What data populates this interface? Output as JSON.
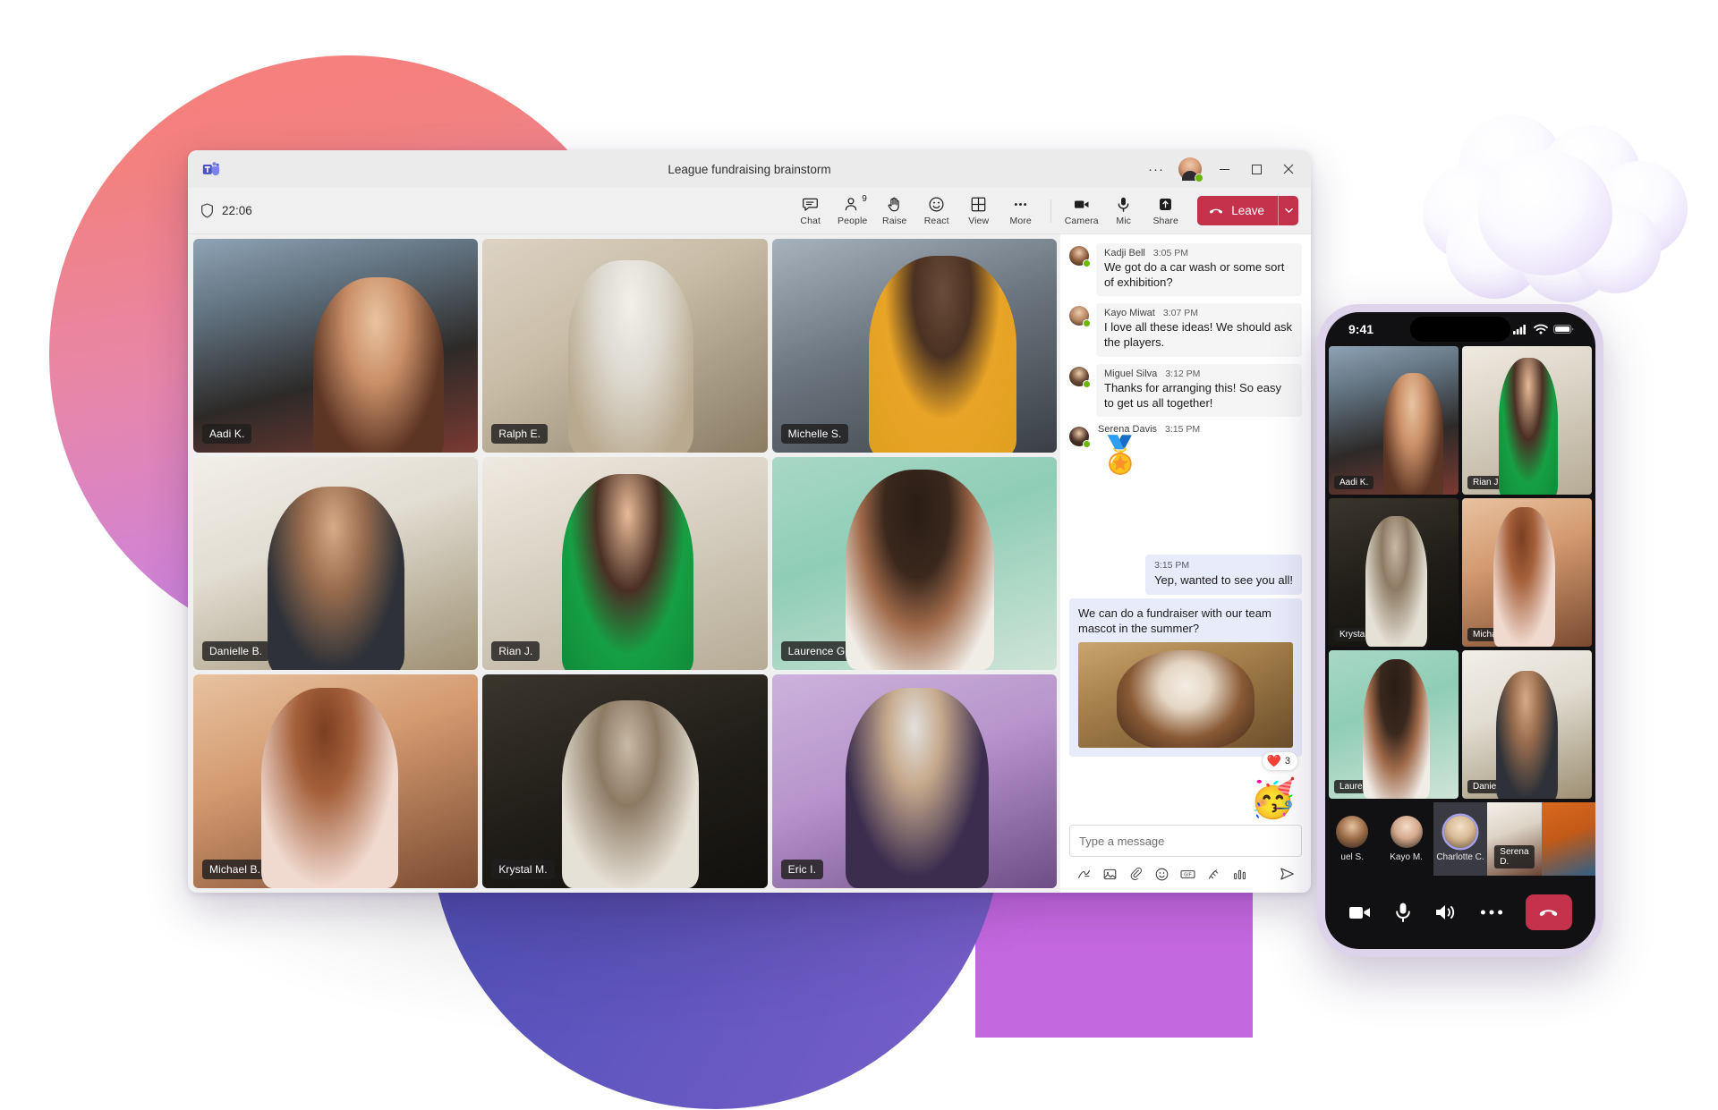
{
  "window": {
    "app_logo": "teams-logo",
    "title": "League fundraising brainstorm",
    "more_options": "···",
    "minimize": "─",
    "maximize": "□",
    "close": "✕"
  },
  "toolbar": {
    "timer": "22:06",
    "shield_icon": "shield-icon",
    "items": [
      {
        "label": "Chat",
        "icon": "chat-icon",
        "badge": ""
      },
      {
        "label": "People",
        "icon": "people-icon",
        "badge": "9"
      },
      {
        "label": "Raise",
        "icon": "raise-hand-icon",
        "badge": ""
      },
      {
        "label": "React",
        "icon": "react-icon",
        "badge": ""
      },
      {
        "label": "View",
        "icon": "view-grid-icon",
        "badge": ""
      },
      {
        "label": "More",
        "icon": "more-icon",
        "badge": ""
      }
    ],
    "device_items": [
      {
        "label": "Camera",
        "icon": "camera-icon"
      },
      {
        "label": "Mic",
        "icon": "microphone-icon"
      },
      {
        "label": "Share",
        "icon": "share-screen-icon"
      }
    ],
    "leave_label": "Leave",
    "leave_color": "#c4314b",
    "leave_chevron": "⌄"
  },
  "video_grid": {
    "tiles": [
      {
        "name": "Aadi K.",
        "art": "t-aadi"
      },
      {
        "name": "Ralph E.",
        "art": "t-ralph"
      },
      {
        "name": "Michelle S.",
        "art": "t-michelle"
      },
      {
        "name": "Danielle B.",
        "art": "t-danielle"
      },
      {
        "name": "Rian J.",
        "art": "t-rian"
      },
      {
        "name": "Laurence G.",
        "art": "t-laurence"
      },
      {
        "name": "Michael B.",
        "art": "t-michael"
      },
      {
        "name": "Krystal M.",
        "art": "t-krystal"
      },
      {
        "name": "Eric I.",
        "art": "t-eric"
      }
    ]
  },
  "chat": {
    "messages": [
      {
        "author": "Kadji Bell",
        "time": "3:05 PM",
        "text": "We got do a car wash or some sort of exhibition?",
        "avatar_color": "#8a5a3a"
      },
      {
        "author": "Kayo Miwat",
        "time": "3:07 PM",
        "text": "I love all these ideas! We should ask the players.",
        "avatar_color": "#b08060"
      },
      {
        "author": "Miguel Silva",
        "time": "3:12 PM",
        "text": "Thanks for arranging this! So easy to get us all together!",
        "avatar_color": "#6a4a34"
      },
      {
        "author": "Serena Davis",
        "time": "3:15 PM",
        "text": "",
        "sticker": "🏅",
        "avatar_color": "#4a3126"
      }
    ],
    "own_messages": [
      {
        "time": "3:15 PM",
        "text": "Yep, wanted to see you all!"
      },
      {
        "time": "",
        "text": "We can do a fundraiser with our team mascot in the summer?",
        "has_photo": true,
        "photo_alt": "bulldog-photo"
      }
    ],
    "reaction": {
      "emoji": "❤️",
      "count": "3"
    },
    "big_emoji": "🥳",
    "composer_placeholder": "Type a message",
    "composer_icons": [
      "format-icon",
      "image-icon",
      "attach-icon",
      "emoji-icon",
      "gif-icon",
      "sticker-icon",
      "poll-icon",
      "send-icon"
    ]
  },
  "phone": {
    "status_time": "9:41",
    "signal_icon": "cellular-signal-icon",
    "wifi_icon": "wifi-icon",
    "battery_icon": "battery-icon",
    "tiles": [
      {
        "name": "Aadi K.",
        "art": "t-aadi"
      },
      {
        "name": "Rian J.",
        "art": "t-rian"
      },
      {
        "name": "Krystal M.",
        "art": "t-krystal"
      },
      {
        "name": "Michael B.",
        "art": "t-michael"
      },
      {
        "name": "Laurence G.",
        "art": "t-laurence"
      },
      {
        "name": "Danielle B.",
        "art": "t-danielle"
      }
    ],
    "roster": [
      {
        "name": "uel S.",
        "type": "avatar",
        "active": false
      },
      {
        "name": "Kayo M.",
        "type": "avatar",
        "active": false
      },
      {
        "name": "Charlotte C.",
        "type": "avatar",
        "active": true
      },
      {
        "name": "Serena D.",
        "type": "video",
        "active": false
      },
      {
        "name": "",
        "type": "video",
        "active": false
      }
    ],
    "controls": [
      {
        "icon": "camera-icon"
      },
      {
        "icon": "microphone-icon"
      },
      {
        "icon": "speaker-icon"
      },
      {
        "icon": "more-icon"
      },
      {
        "icon": "hangup-icon"
      }
    ],
    "hangup_color": "#c4314b"
  },
  "decor": {
    "cloud": "3d-cloud-shape",
    "blob_pink": "#e886a8",
    "blob_purple": "#5a54bd",
    "blob_magenta": "#c76ae0"
  }
}
